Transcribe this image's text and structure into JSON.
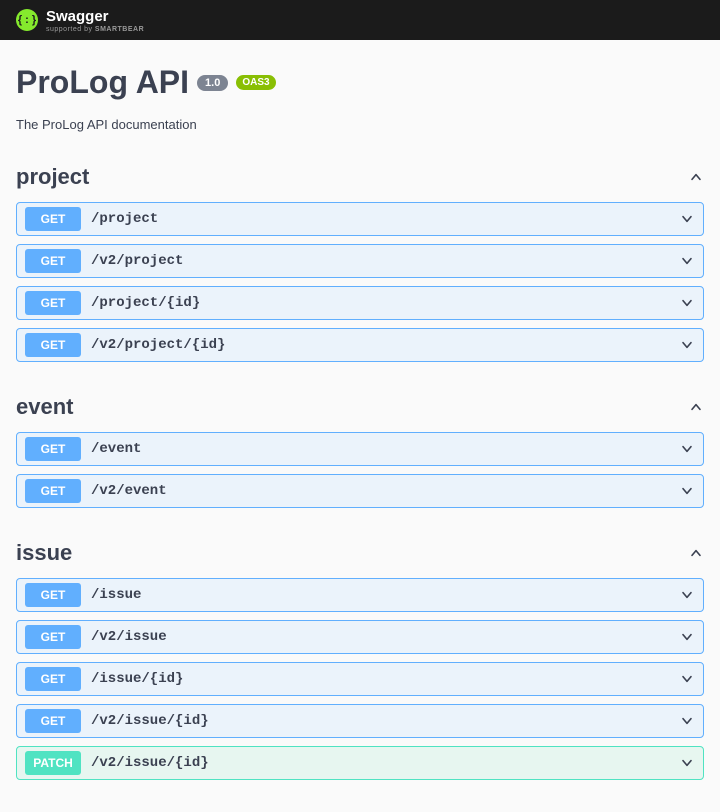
{
  "brand": {
    "name": "Swagger",
    "supported_prefix": "supported by ",
    "supported_by": "SMARTBEAR",
    "icon_glyph": "{ : }"
  },
  "api": {
    "title": "ProLog API",
    "version": "1.0",
    "oas_badge": "OAS3",
    "description": "The ProLog API documentation"
  },
  "tags": [
    {
      "name": "project",
      "operations": [
        {
          "method": "GET",
          "path": "/project"
        },
        {
          "method": "GET",
          "path": "/v2/project"
        },
        {
          "method": "GET",
          "path": "/project/{id}"
        },
        {
          "method": "GET",
          "path": "/v2/project/{id}"
        }
      ]
    },
    {
      "name": "event",
      "operations": [
        {
          "method": "GET",
          "path": "/event"
        },
        {
          "method": "GET",
          "path": "/v2/event"
        }
      ]
    },
    {
      "name": "issue",
      "operations": [
        {
          "method": "GET",
          "path": "/issue"
        },
        {
          "method": "GET",
          "path": "/v2/issue"
        },
        {
          "method": "GET",
          "path": "/issue/{id}"
        },
        {
          "method": "GET",
          "path": "/v2/issue/{id}"
        },
        {
          "method": "PATCH",
          "path": "/v2/issue/{id}"
        }
      ]
    }
  ],
  "colors": {
    "get": "#61affe",
    "patch": "#50e3c2"
  }
}
